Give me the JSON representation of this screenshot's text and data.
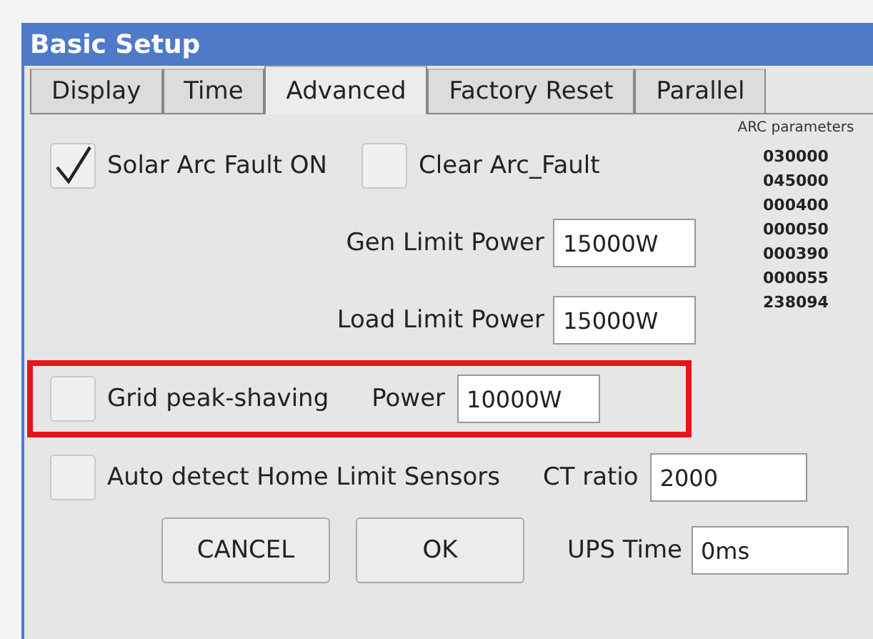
{
  "window": {
    "title": "Basic Setup"
  },
  "tabs": [
    {
      "label": "Display",
      "selected": false
    },
    {
      "label": "Time",
      "selected": false
    },
    {
      "label": "Advanced",
      "selected": true
    },
    {
      "label": "Factory Reset",
      "selected": false
    },
    {
      "label": "Parallel",
      "selected": false
    }
  ],
  "arc_fault": {
    "label": "Solar Arc Fault ON",
    "checked": true
  },
  "clear_fault": {
    "label": "Clear Arc_Fault",
    "checked": false
  },
  "arc_parameters": {
    "title": "ARC parameters",
    "values": [
      "030000",
      "045000",
      "000400",
      "000050",
      "000390",
      "000055",
      "238094"
    ]
  },
  "gen_limit": {
    "label": "Gen Limit Power",
    "value": "15000W"
  },
  "load_limit": {
    "label": "Load Limit Power",
    "value": "15000W"
  },
  "grid_peak": {
    "label": "Grid peak-shaving",
    "checked": false,
    "power_label": "Power",
    "power_value": "10000W"
  },
  "auto_detect": {
    "label": "Auto detect Home Limit Sensors",
    "checked": false
  },
  "ct_ratio": {
    "label": "CT ratio",
    "value": "2000"
  },
  "ups_time": {
    "label": "UPS Time",
    "value": "0ms"
  },
  "buttons": [
    "CANCEL",
    "OK"
  ]
}
